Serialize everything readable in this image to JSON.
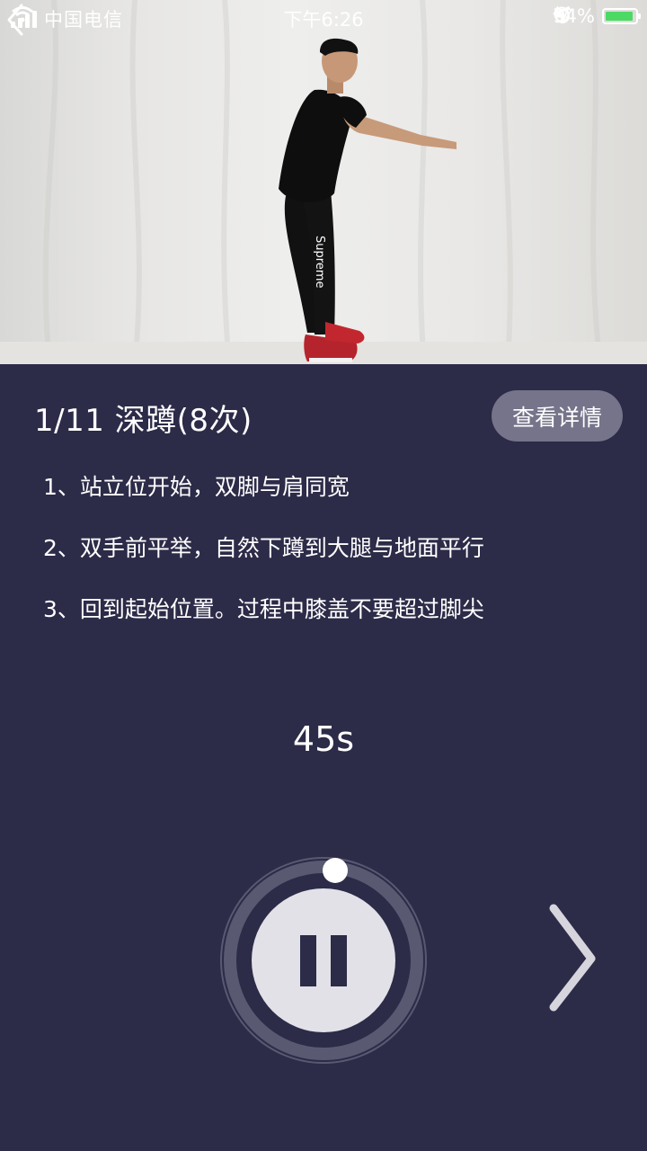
{
  "status_bar": {
    "carrier": "中国电信",
    "time": "下午6:26",
    "battery": "94%",
    "battery_level": 0.94,
    "battery_color": "#4cd964"
  },
  "video": {
    "shirt_text": "Supreme"
  },
  "icons": {
    "back": "chevron-left-icon",
    "pause": "pause-icon",
    "next": "chevron-right-icon"
  },
  "exercise": {
    "title": "1/11 深蹲(8次)",
    "detail_button": "查看详情",
    "steps": [
      "1、站立位开始，双脚与肩同宽",
      "2、双手前平举，自然下蹲到大腿与地面平行",
      "3、回到起始位置。过程中膝盖不要超过脚尖"
    ]
  },
  "timer": {
    "display": "45s"
  },
  "colors": {
    "panel_bg": "#2c2b48",
    "button_bg": "#75748a",
    "control_light": "#e2e1e8"
  }
}
